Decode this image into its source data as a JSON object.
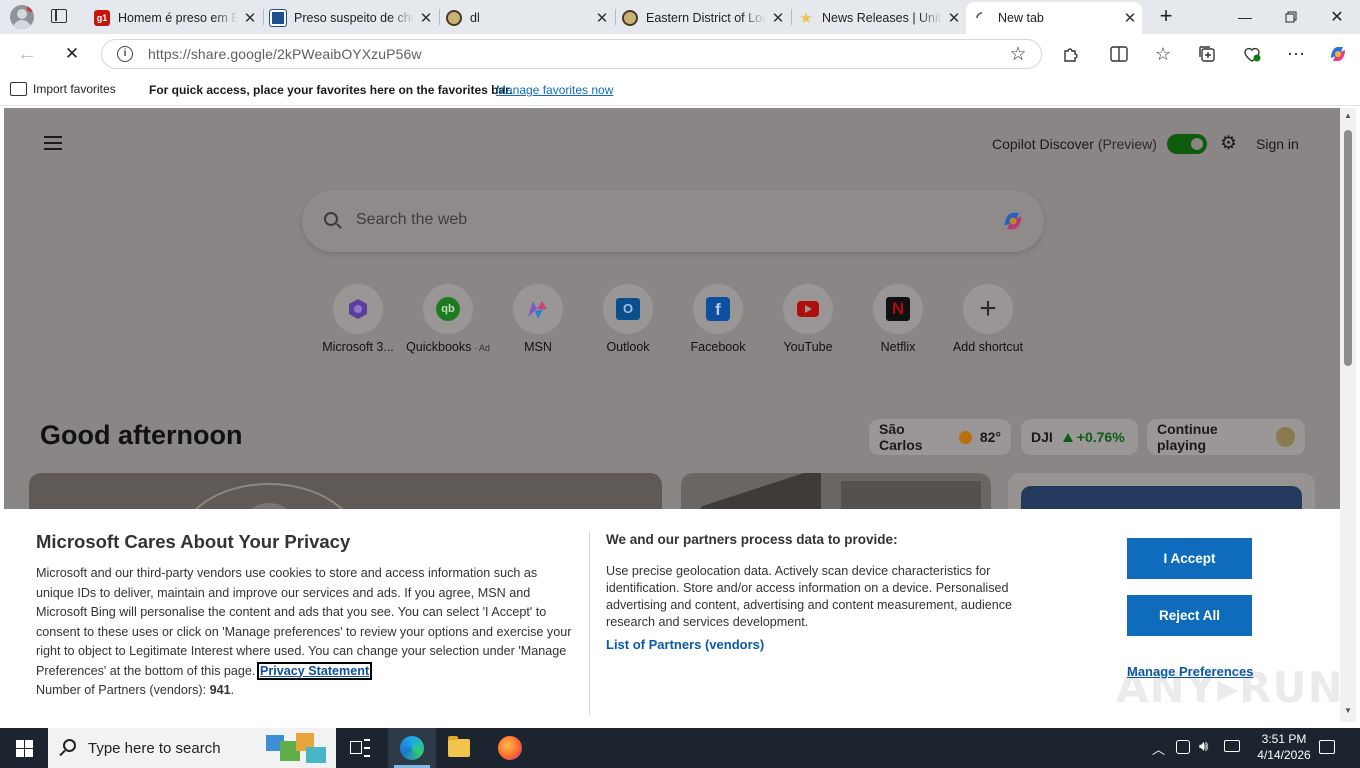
{
  "browser": {
    "tabs": [
      {
        "title": "Homem é preso em Bauru",
        "icon": "g1-favicon"
      },
      {
        "title": "Preso suspeito de chefiar",
        "icon": "news-favicon"
      },
      {
        "title": "dl",
        "icon": "seal-favicon"
      },
      {
        "title": "Eastern District of Louisiana",
        "icon": "seal-favicon"
      },
      {
        "title": "News Releases | United States",
        "icon": "star-favicon"
      },
      {
        "title": "New tab",
        "icon": "loading-spinner",
        "active": true
      }
    ],
    "url": "https://share.google/2kPWeaibOYXzuP56w",
    "favorites_bar": {
      "import_label": "Import favorites",
      "message": "For quick access, place your favorites here on the favorites bar.",
      "manage_link": "Manage favorites now"
    }
  },
  "newtab": {
    "copilot_discover_label": "Copilot Discover",
    "preview_label": "(Preview)",
    "sign_in": "Sign in",
    "search_placeholder": "Search the web",
    "shortcuts": [
      {
        "label": "Microsoft 3...",
        "icon": "microsoft365-icon"
      },
      {
        "label": "Quickbooks",
        "ad": "Ad",
        "icon": "quickbooks-icon"
      },
      {
        "label": "MSN",
        "icon": "msn-icon"
      },
      {
        "label": "Outlook",
        "icon": "outlook-icon"
      },
      {
        "label": "Facebook",
        "icon": "facebook-icon"
      },
      {
        "label": "YouTube",
        "icon": "youtube-icon"
      },
      {
        "label": "Netflix",
        "icon": "netflix-icon"
      },
      {
        "label": "Add shortcut",
        "icon": "plus-icon"
      }
    ],
    "greeting": "Good afternoon",
    "weather": {
      "city": "São Carlos",
      "temp": "82°"
    },
    "stock": {
      "ticker": "DJI",
      "change": "+0.76%"
    },
    "continue_playing": "Continue playing"
  },
  "consent": {
    "title": "Microsoft Cares About Your Privacy",
    "body": "Microsoft and our third-party vendors use cookies to store and access information such as unique IDs to deliver, maintain and improve our services and ads. If you agree, MSN and Microsoft Bing will personalise the content and ads that you see. You can select 'I Accept' to consent to these uses or click on 'Manage preferences' to review your options and exercise your right to object to Legitimate Interest where used.  You can change your selection under 'Manage Preferences' at the bottom of this page.",
    "privacy_link": "Privacy Statement",
    "partners_label": "Number of Partners (vendors):",
    "partners_count": "941",
    "partners_suffix": ".",
    "process_title": "We and our partners process data to provide:",
    "process_body": "Use precise geolocation data. Actively scan device characteristics for identification. Store and/or access information on a device. Personalised advertising and content, advertising and content measurement, audience research and services development.",
    "partners_list_link": "List of Partners (vendors)",
    "accept": "I Accept",
    "reject": "Reject All",
    "manage": "Manage Preferences"
  },
  "taskbar": {
    "search_placeholder": "Type here to search",
    "time": "3:51 PM",
    "date": "4/14/2026"
  },
  "colors": {
    "accent_blue": "#0f6cbd",
    "toggle_green": "#107c10",
    "taskbar": "#1c2430"
  }
}
